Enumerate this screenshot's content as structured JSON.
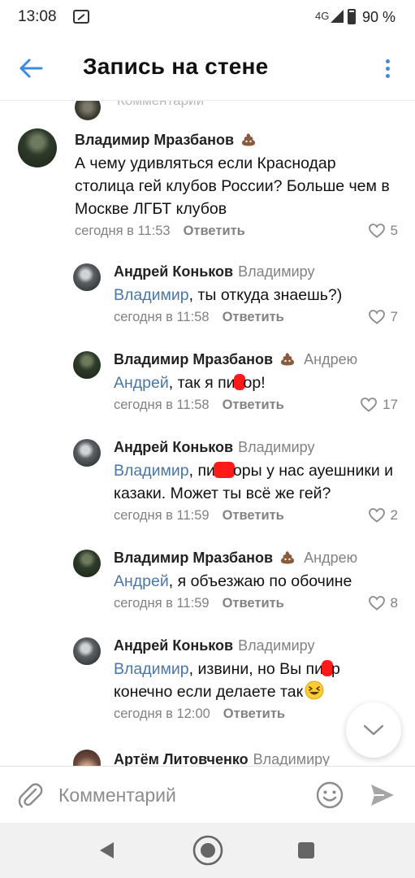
{
  "status_bar": {
    "time": "13:08",
    "network": "4G",
    "battery": "90 %"
  },
  "header": {
    "title": "Запись на стене"
  },
  "top_partial": {
    "text": "Комментарий"
  },
  "comments": [
    {
      "author": "Владимир Мразбанов",
      "reply_to": "",
      "mention": "",
      "text_parts": [
        "А чему удивляться если Краснодар столица гей клубов России? Больше чем в Москве ЛГБТ клубов"
      ],
      "time": "сегодня в 11:53",
      "reply_label": "Ответить",
      "likes": "5"
    },
    {
      "author": "Андрей Коньков",
      "reply_to": "Владимиру",
      "mention": "Владимир",
      "text_parts": [
        ", ты откуда знаешь?)"
      ],
      "time": "сегодня в 11:58",
      "reply_label": "Ответить",
      "likes": "7"
    },
    {
      "author": "Владимир Мразбанов",
      "reply_to": "Андрею",
      "mention": "Андрей",
      "text_parts": [
        ", так я пи",
        "ор!"
      ],
      "time": "сегодня в 11:58",
      "reply_label": "Ответить",
      "likes": "17"
    },
    {
      "author": "Андрей Коньков",
      "reply_to": "Владимиру",
      "mention": "Владимир",
      "text_parts": [
        ", пи",
        "оры у нас ауешники и казаки. Может ты всё же гей?"
      ],
      "time": "сегодня в 11:59",
      "reply_label": "Ответить",
      "likes": "2"
    },
    {
      "author": "Владимир Мразбанов",
      "reply_to": "Андрею",
      "mention": "Андрей",
      "text_parts": [
        ", я объезжаю по обочине"
      ],
      "time": "сегодня в 11:59",
      "reply_label": "Ответить",
      "likes": "8"
    },
    {
      "author": "Андрей Коньков",
      "reply_to": "Владимиру",
      "mention": "Владимир",
      "text_parts": [
        ", извини, но Вы пи",
        "р конечно если делаете так"
      ],
      "time": "сегодня в 12:00",
      "reply_label": "Ответить",
      "likes": ""
    },
    {
      "author": "Артём Литовченко",
      "reply_to": "Владимиру"
    }
  ],
  "composer": {
    "placeholder": "Комментарий"
  },
  "colors": {
    "accent": "#3f8ae0",
    "mention": "#4a76a8",
    "redaction": "#ff1a1a",
    "muted": "#828282"
  },
  "icons": [
    "back-arrow-icon",
    "more-vertical-icon",
    "poo-emoji-icon",
    "heart-icon",
    "grinning-squinting-emoji-icon",
    "chevron-down-icon",
    "paperclip-icon",
    "smile-icon",
    "send-icon",
    "nav-back-icon",
    "nav-home-icon",
    "nav-recents-icon"
  ]
}
